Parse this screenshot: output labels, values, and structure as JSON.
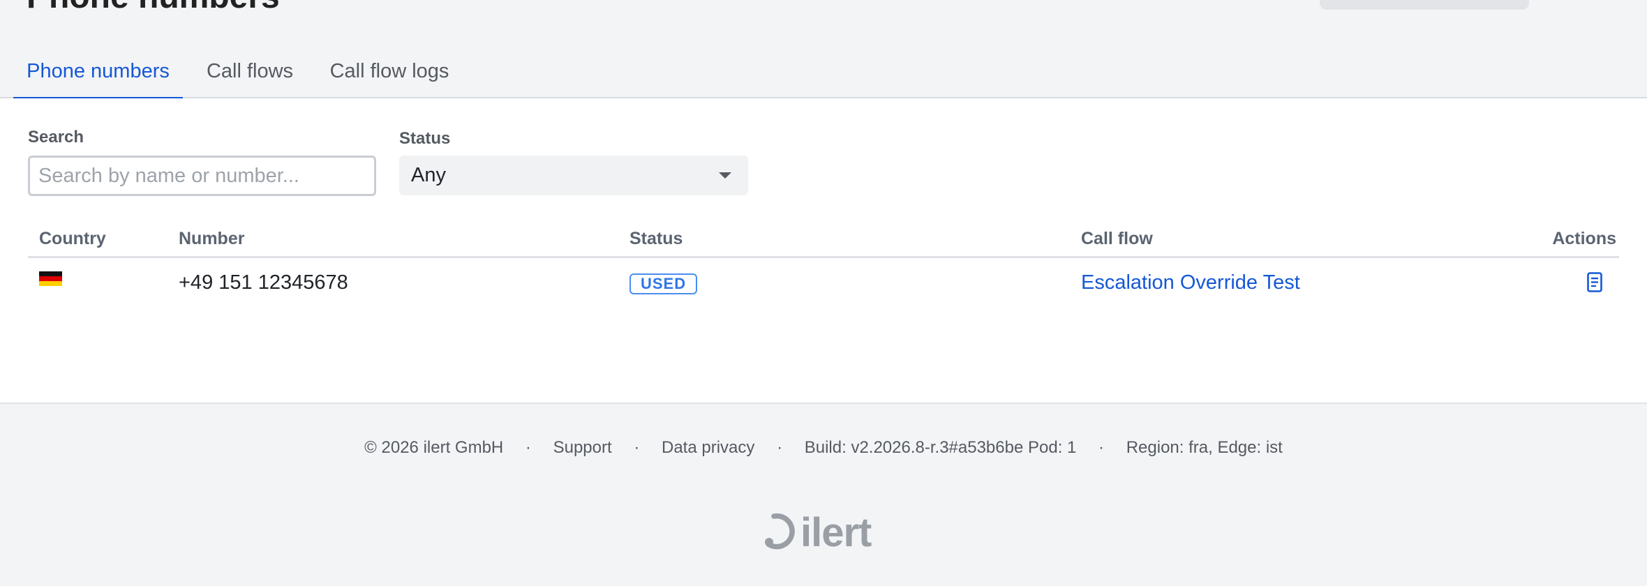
{
  "page": {
    "title": "Phone numbers"
  },
  "tabs": [
    {
      "label": "Phone numbers",
      "active": true
    },
    {
      "label": "Call flows",
      "active": false
    },
    {
      "label": "Call flow logs",
      "active": false
    }
  ],
  "filters": {
    "search_label": "Search",
    "search_placeholder": "Search by name or number...",
    "search_value": "",
    "status_label": "Status",
    "status_value": "Any"
  },
  "table": {
    "columns": [
      "Country",
      "Number",
      "Status",
      "Call flow",
      "Actions"
    ],
    "rows": [
      {
        "country_icon": "flag-de-icon",
        "number": "+49 151 12345678",
        "status": "USED",
        "call_flow": "Escalation Override Test",
        "action_icon": "document-icon"
      }
    ]
  },
  "footer": {
    "copyright": "© 2026 ilert GmbH",
    "support": "Support",
    "privacy": "Data privacy",
    "build": "Build: v2.2026.8-r.3#a53b6be Pod: 1",
    "region": "Region: fra, Edge: ist",
    "separator": "·",
    "logo_text": "ilert"
  },
  "colors": {
    "accent": "#1558d6",
    "badge": "#2f76e6",
    "background": "#f3f4f6",
    "panel": "#ffffff"
  }
}
